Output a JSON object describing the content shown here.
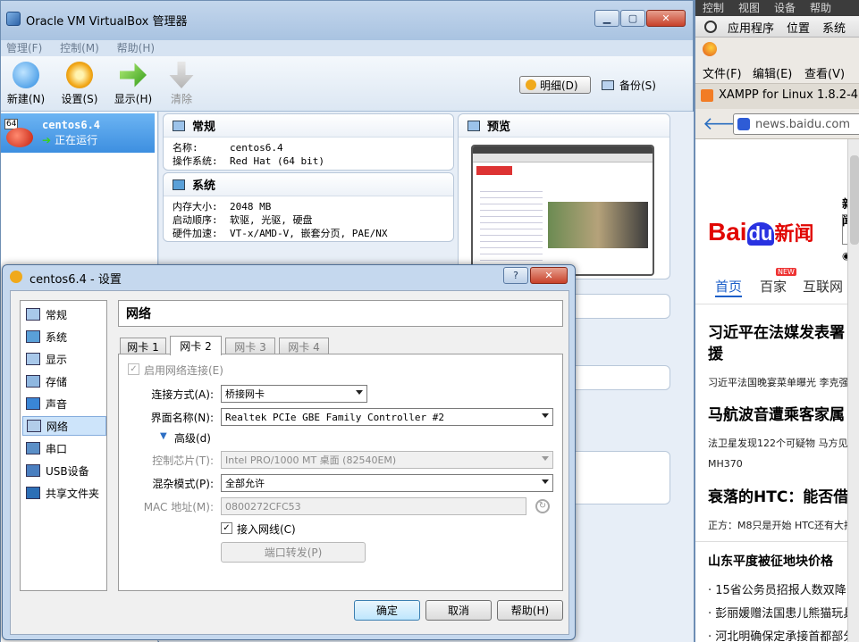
{
  "vbox": {
    "title": "Oracle VM VirtualBox 管理器",
    "menu": [
      "管理(F)",
      "控制(M)",
      "帮助(H)"
    ],
    "toolbar": {
      "new_label": "新建(N)",
      "settings_label": "设置(S)",
      "show_label": "显示(H)",
      "discard_label": "清除",
      "details_label": "明细(D)",
      "snapshots_label": "备份(S)"
    },
    "vm": {
      "badge": "64",
      "name": "centos6.4",
      "state": "正在运行"
    },
    "general": {
      "header": "常规",
      "name_key": "名称:",
      "name_val": "centos6.4",
      "os_key": "操作系统:",
      "os_val": "Red Hat (64 bit)"
    },
    "system": {
      "header": "系统",
      "mem_key": "内存大小:",
      "mem_val": "2048 MB",
      "boot_key": "启动顺序:",
      "boot_val": "软驱, 光驱, 硬盘",
      "accel_key": "硬件加速:",
      "accel_val": "VT-x/AMD-V, 嵌套分页, PAE/NX"
    },
    "preview": {
      "header": "预览"
    }
  },
  "firefox": {
    "gnome_top": [
      "控制",
      "视图",
      "设备",
      "帮助"
    ],
    "gnome_menu": [
      "应用程序",
      "位置",
      "系统"
    ],
    "menu": [
      "文件(F)",
      "编辑(E)",
      "查看(V)"
    ],
    "tab_title": "XAMPP for Linux 1.8.2-4",
    "url": "news.baidu.com",
    "logo_bai": "Bai",
    "logo_du": "du",
    "logo_news": "新闻",
    "search_fragment": "新闻",
    "new_badge": "NEW",
    "nav": [
      "首页",
      "百家",
      "互联网"
    ],
    "headlines": [
      {
        "title": "习近平在法媒发表署",
        "title2": "援",
        "sub": "习近平法国晚宴菜单曝光 李克强"
      },
      {
        "title": "马航波音遭乘客家属",
        "sub": "法卫星发现122个可疑物 马方见",
        "sub2": "MH370"
      },
      {
        "title": "衰落的HTC：能否借",
        "sub": "正方：M8只是开始 HTC还有大招"
      }
    ],
    "section_title": "山东平度被征地块价格",
    "list": [
      "· 15省公务员招报人数双降 许",
      "· 彭丽媛赠法国患儿熊猫玩具",
      "· 河北明确保定承接首都部分"
    ]
  },
  "dialog": {
    "title": "centos6.4 - 设置",
    "help_glyph": "?",
    "close_glyph": "✕",
    "categories": [
      "常规",
      "系统",
      "显示",
      "存储",
      "声音",
      "网络",
      "串口",
      "USB设备",
      "共享文件夹"
    ],
    "selected_category": "网络",
    "page_title": "网络",
    "tabs": [
      "网卡 1",
      "网卡 2",
      "网卡 3",
      "网卡 4"
    ],
    "enable_label": "启用网络连接(E)",
    "attach_label": "连接方式(A):",
    "attach_value": "桥接网卡",
    "iface_label": "界面名称(N):",
    "iface_value": "Realtek PCIe GBE Family Controller #2",
    "advanced_label": "高级(d)",
    "adapter_label": "控制芯片(T):",
    "adapter_value": "Intel PRO/1000 MT 桌面 (82540EM)",
    "promisc_label": "混杂模式(P):",
    "promisc_value": "全部允许",
    "mac_label": "MAC 地址(M):",
    "mac_value": "0800272CFC53",
    "cable_label": "接入网线(C)",
    "portfwd_label": "端口转发(P)",
    "ok_label": "确定",
    "cancel_label": "取消",
    "help_label": "帮助(H)"
  }
}
